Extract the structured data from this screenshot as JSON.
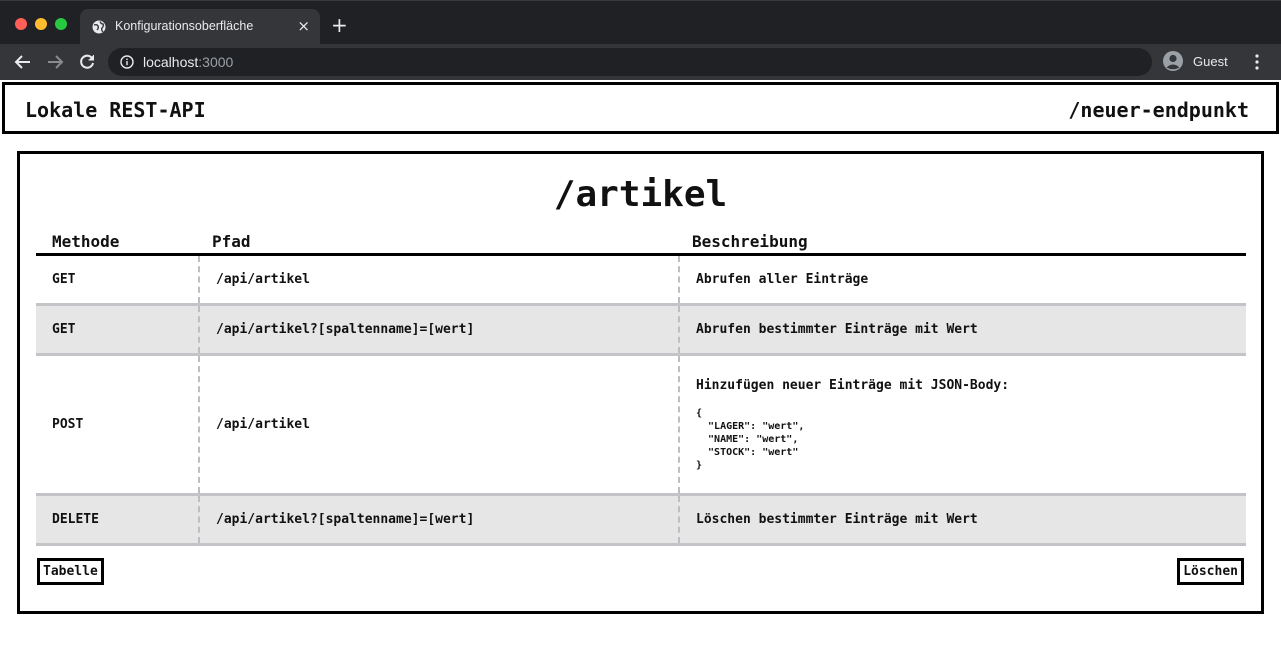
{
  "browser": {
    "tab_title": "Konfigurationsoberfläche",
    "tab_close": "×",
    "new_tab": "+",
    "url_host": "localhost",
    "url_port": ":3000",
    "profile_name": "Guest"
  },
  "header": {
    "app_title": "Lokale REST-API",
    "new_endpoint_link": "/neuer-endpunkt"
  },
  "endpoint": {
    "title": "/artikel",
    "columns": {
      "method": "Methode",
      "path": "Pfad",
      "description": "Beschreibung"
    },
    "rows": [
      {
        "method": "GET",
        "path": "/api/artikel",
        "description": "Abrufen aller Einträge"
      },
      {
        "method": "GET",
        "path": "/api/artikel?[spaltenname]=[wert]",
        "description": "Abrufen bestimmter Einträge mit Wert"
      },
      {
        "method": "POST",
        "path": "/api/artikel",
        "description": "Hinzufügen neuer Einträge mit JSON-Body:",
        "code": "{\n  \"LAGER\": \"wert\",\n  \"NAME\": \"wert\",\n  \"STOCK\": \"wert\"\n}"
      },
      {
        "method": "DELETE",
        "path": "/api/artikel?[spaltenname]=[wert]",
        "description": "Löschen bestimmter Einträge mit Wert"
      }
    ],
    "table_button": "Tabelle",
    "delete_button": "Löschen"
  }
}
